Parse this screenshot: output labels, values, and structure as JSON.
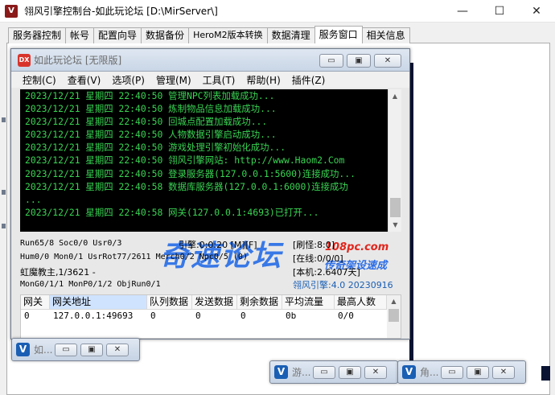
{
  "window": {
    "title": "翎风引擎控制台-如此玩论坛 [D:\\MirServer\\]",
    "minimize": "—",
    "maximize": "☐",
    "close": "✕"
  },
  "tabs": [
    {
      "label": "服务器控制"
    },
    {
      "label": "帐号"
    },
    {
      "label": "配置向导"
    },
    {
      "label": "数据备份"
    },
    {
      "label": "HeroM2版本转换"
    },
    {
      "label": "数据清理"
    },
    {
      "label": "服务窗口"
    },
    {
      "label": "相关信息"
    }
  ],
  "inner": {
    "icon_text": "DX",
    "title": "如此玩论坛 [无限版]",
    "minimize": "▭",
    "maximize": "▣",
    "close": "✕",
    "menu": [
      "控制(C)",
      "查看(V)",
      "选项(P)",
      "管理(M)",
      "工具(T)",
      "帮助(H)",
      "插件(Z)"
    ],
    "console": [
      "2023/12/21 星期四 22:40:50 管理NPC列表加载成功...",
      "2023/12/21 星期四 22:40:50 炼制物品信息加载成功...",
      "2023/12/21 星期四 22:40:50 回城点配置加载成功...",
      "2023/12/21 星期四 22:40:50 人物数据引擎启动成功...",
      "2023/12/21 星期四 22:40:50 游戏处理引擎初始化成功...",
      "2023/12/21 星期四 22:40:50 翎风引擎网站: http://www.Haom2.Com",
      "2023/12/21 星期四 22:40:50 登录服务器(127.0.0.1:5600)连接成功...",
      "2023/12/21 星期四 22:40:58 数据库服务器(127.0.0.1:6000)连接成功",
      "...",
      "2023/12/21 星期四 22:40:58 网关(127.0.0.1:4693)已打开..."
    ],
    "watermark": {
      "big": "奇速论坛",
      "url": "108pc.com",
      "sub": "传奇架设速成"
    },
    "stats": {
      "run": "Run65/8 Soc0/0 Usr0/3",
      "engine": "引擎:0:0:20 [M][F]",
      "refresh": "[刷怪:8:0]",
      "hum": "Hum0/0 Mon0/1 UsrRot77/2611 Merch0/2 Npc0/5 (0)",
      "online": "[在线:0/0/0]",
      "boss": "虹魔教主,1/3621 -",
      "local": "[本机:2.6407天]",
      "mongo": "MonG0/1/1 MonP0/1/2 ObjRun0/1",
      "version": "翎风引擎:4.0 20230916"
    },
    "grid": {
      "headers": [
        "网关",
        "网关地址",
        "队列数据",
        "发送数据",
        "剩余数据",
        "平均流量",
        "最高人数"
      ],
      "rows": [
        [
          "0",
          "127.0.0.1:49693",
          "0",
          "0",
          "0",
          "0b",
          "0/0"
        ]
      ]
    }
  },
  "minimized": [
    {
      "label": "如..."
    },
    {
      "label": "游..."
    },
    {
      "label": "角..."
    }
  ]
}
